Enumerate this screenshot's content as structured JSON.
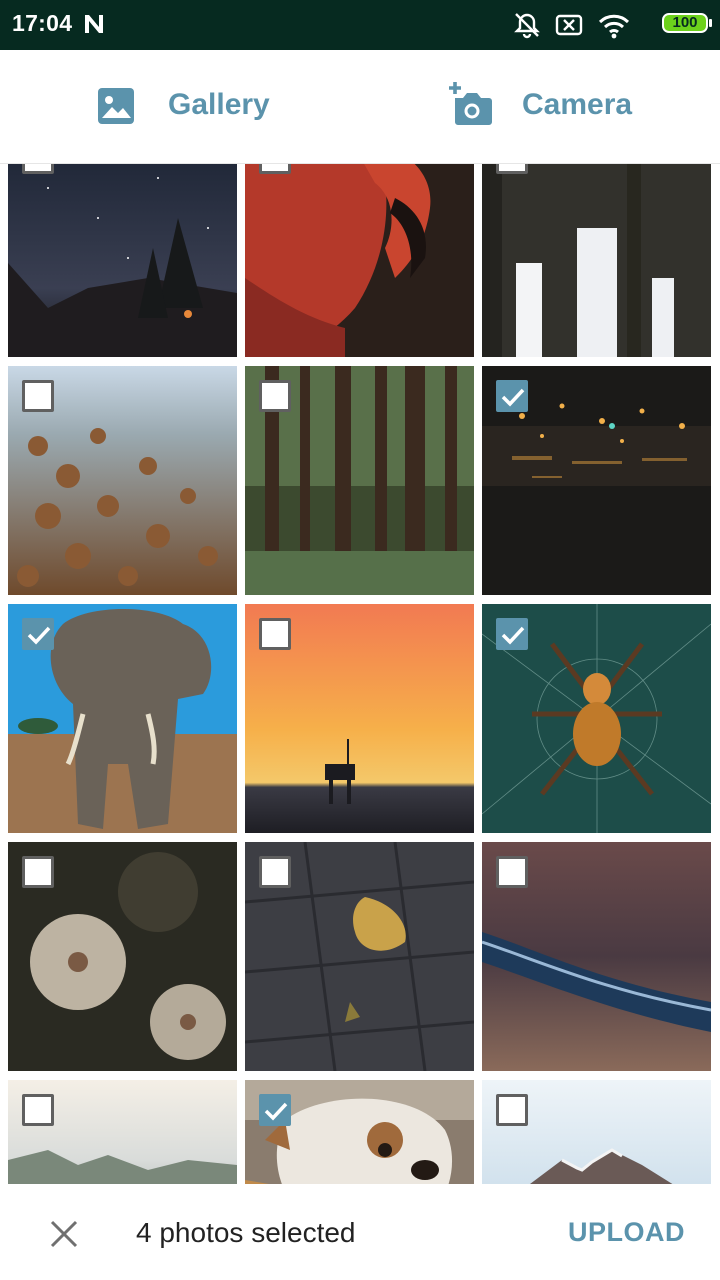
{
  "status_bar": {
    "time": "17:04",
    "battery": "100",
    "icons": [
      "n-notification-icon",
      "alarm-off-icon",
      "sim-x-icon",
      "wifi-icon",
      "battery-icon"
    ]
  },
  "tabs": {
    "gallery_label": "Gallery",
    "camera_label": "Camera"
  },
  "photos": [
    {
      "subject": "night-sky",
      "checked": false
    },
    {
      "subject": "flamingo",
      "checked": false
    },
    {
      "subject": "ruins-arches",
      "checked": false
    },
    {
      "subject": "dried-flowers",
      "checked": false
    },
    {
      "subject": "forest",
      "checked": false
    },
    {
      "subject": "city-lights-water",
      "checked": true
    },
    {
      "subject": "elephant",
      "checked": true
    },
    {
      "subject": "sunset-lifeguard-tower",
      "checked": false
    },
    {
      "subject": "spider",
      "checked": true
    },
    {
      "subject": "white-flowers",
      "checked": false
    },
    {
      "subject": "leaf-on-pavement",
      "checked": false
    },
    {
      "subject": "wave-shore",
      "checked": false
    },
    {
      "subject": "mountains",
      "checked": false
    },
    {
      "subject": "bulldog",
      "checked": true
    },
    {
      "subject": "snowy-peaks",
      "checked": false
    }
  ],
  "bottom_bar": {
    "selected_text": "4 photos selected",
    "upload_label": "UPLOAD"
  },
  "colors": {
    "accent": "#5b93ac",
    "status_bar": "#062a20",
    "battery": "#6cd21c"
  }
}
